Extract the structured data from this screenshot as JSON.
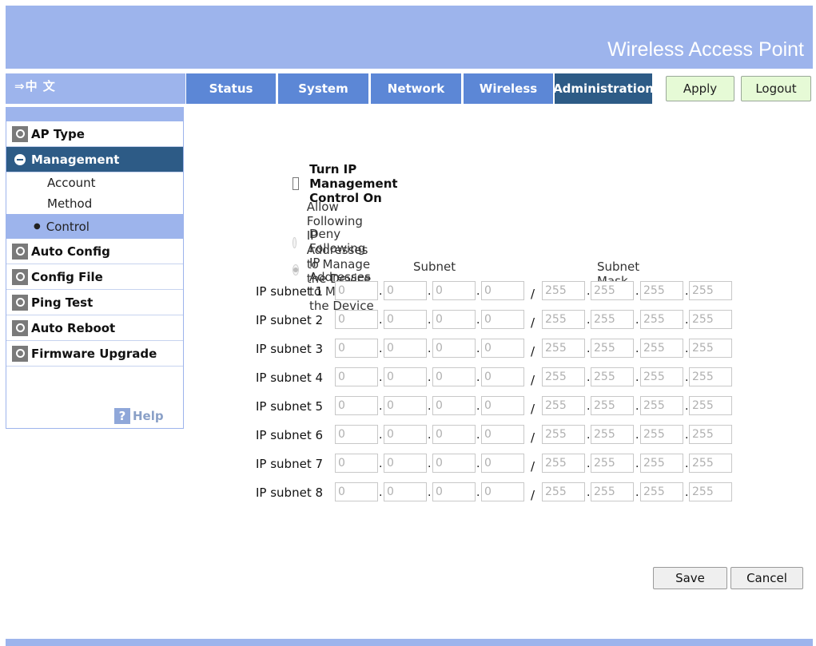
{
  "header": {
    "title": "Wireless Access Point"
  },
  "language": {
    "label": "⇒中 文"
  },
  "tabs": [
    "Status",
    "System",
    "Network",
    "Wireless",
    "Administration"
  ],
  "active_tab": "Administration",
  "actions": {
    "apply": "Apply",
    "logout": "Logout"
  },
  "sidebar": {
    "items": [
      "AP Type",
      "Management",
      "Auto Config",
      "Config File",
      "Ping Test",
      "Auto Reboot",
      "Firmware Upgrade"
    ],
    "active_item": "Management",
    "subitems": [
      "Account",
      "Method",
      "Control"
    ],
    "selected_subitem": "Control",
    "help": "Help"
  },
  "form": {
    "checkbox_label": "Turn IP Management Control On",
    "checkbox_checked": false,
    "radio_allow": "Allow Following IP Addresses to Manage the Device",
    "radio_deny": "Deny Following IP Addresses to Manage the Device",
    "radio_selected": "deny",
    "col_subnet": "Subnet",
    "col_mask": "Subnet Mask",
    "separator_dot": ".",
    "separator_slash": "/",
    "rows": [
      {
        "label": "IP subnet 1",
        "subnet": [
          "0",
          "0",
          "0",
          "0"
        ],
        "mask": [
          "255",
          "255",
          "255",
          "255"
        ]
      },
      {
        "label": "IP subnet 2",
        "subnet": [
          "0",
          "0",
          "0",
          "0"
        ],
        "mask": [
          "255",
          "255",
          "255",
          "255"
        ]
      },
      {
        "label": "IP subnet 3",
        "subnet": [
          "0",
          "0",
          "0",
          "0"
        ],
        "mask": [
          "255",
          "255",
          "255",
          "255"
        ]
      },
      {
        "label": "IP subnet 4",
        "subnet": [
          "0",
          "0",
          "0",
          "0"
        ],
        "mask": [
          "255",
          "255",
          "255",
          "255"
        ]
      },
      {
        "label": "IP subnet 5",
        "subnet": [
          "0",
          "0",
          "0",
          "0"
        ],
        "mask": [
          "255",
          "255",
          "255",
          "255"
        ]
      },
      {
        "label": "IP subnet 6",
        "subnet": [
          "0",
          "0",
          "0",
          "0"
        ],
        "mask": [
          "255",
          "255",
          "255",
          "255"
        ]
      },
      {
        "label": "IP subnet 7",
        "subnet": [
          "0",
          "0",
          "0",
          "0"
        ],
        "mask": [
          "255",
          "255",
          "255",
          "255"
        ]
      },
      {
        "label": "IP subnet 8",
        "subnet": [
          "0",
          "0",
          "0",
          "0"
        ],
        "mask": [
          "255",
          "255",
          "255",
          "255"
        ]
      }
    ]
  },
  "buttons": {
    "save": "Save",
    "cancel": "Cancel"
  },
  "colors": {
    "header_bg": "#9db4ec",
    "tab_bg": "#5c87d6",
    "active_bg": "#2d5b86",
    "action_btn_bg": "#e6fad6"
  }
}
